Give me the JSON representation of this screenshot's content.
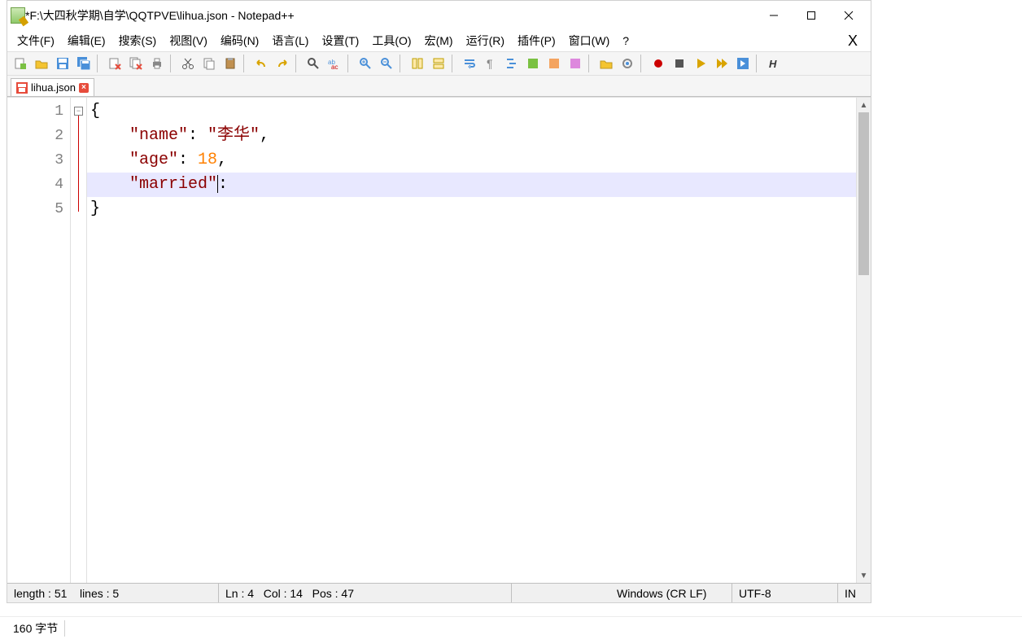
{
  "titlebar": {
    "title": "*F:\\大四秋学期\\自学\\QQTPVE\\lihua.json - Notepad++"
  },
  "menu": {
    "file": "文件(F)",
    "edit": "编辑(E)",
    "search": "搜索(S)",
    "view": "视图(V)",
    "encoding": "编码(N)",
    "language": "语言(L)",
    "settings": "设置(T)",
    "tools": "工具(O)",
    "macro": "宏(M)",
    "run": "运行(R)",
    "plugins": "插件(P)",
    "window": "窗口(W)",
    "help": "?",
    "close_x": "X"
  },
  "tab": {
    "filename": "lihua.json"
  },
  "editor": {
    "lines": [
      {
        "n": "1",
        "type": "brace",
        "text": "{"
      },
      {
        "n": "2",
        "type": "prop",
        "key": "\"name\"",
        "sep": ": ",
        "val": "\"李华\"",
        "valKind": "str",
        "tail": ","
      },
      {
        "n": "3",
        "type": "prop",
        "key": "\"age\"",
        "sep": ": ",
        "val": "18",
        "valKind": "num",
        "tail": ","
      },
      {
        "n": "4",
        "type": "cursor",
        "key": "\"married\"",
        "tail": ":"
      },
      {
        "n": "5",
        "type": "brace",
        "text": "}"
      }
    ]
  },
  "status": {
    "length": "length : 51",
    "lines": "lines : 5",
    "ln": "Ln : 4",
    "col": "Col : 14",
    "pos": "Pos : 47",
    "eol": "Windows (CR LF)",
    "encoding": "UTF-8",
    "ins": "IN"
  },
  "footer": {
    "bytes": "160 字节"
  }
}
